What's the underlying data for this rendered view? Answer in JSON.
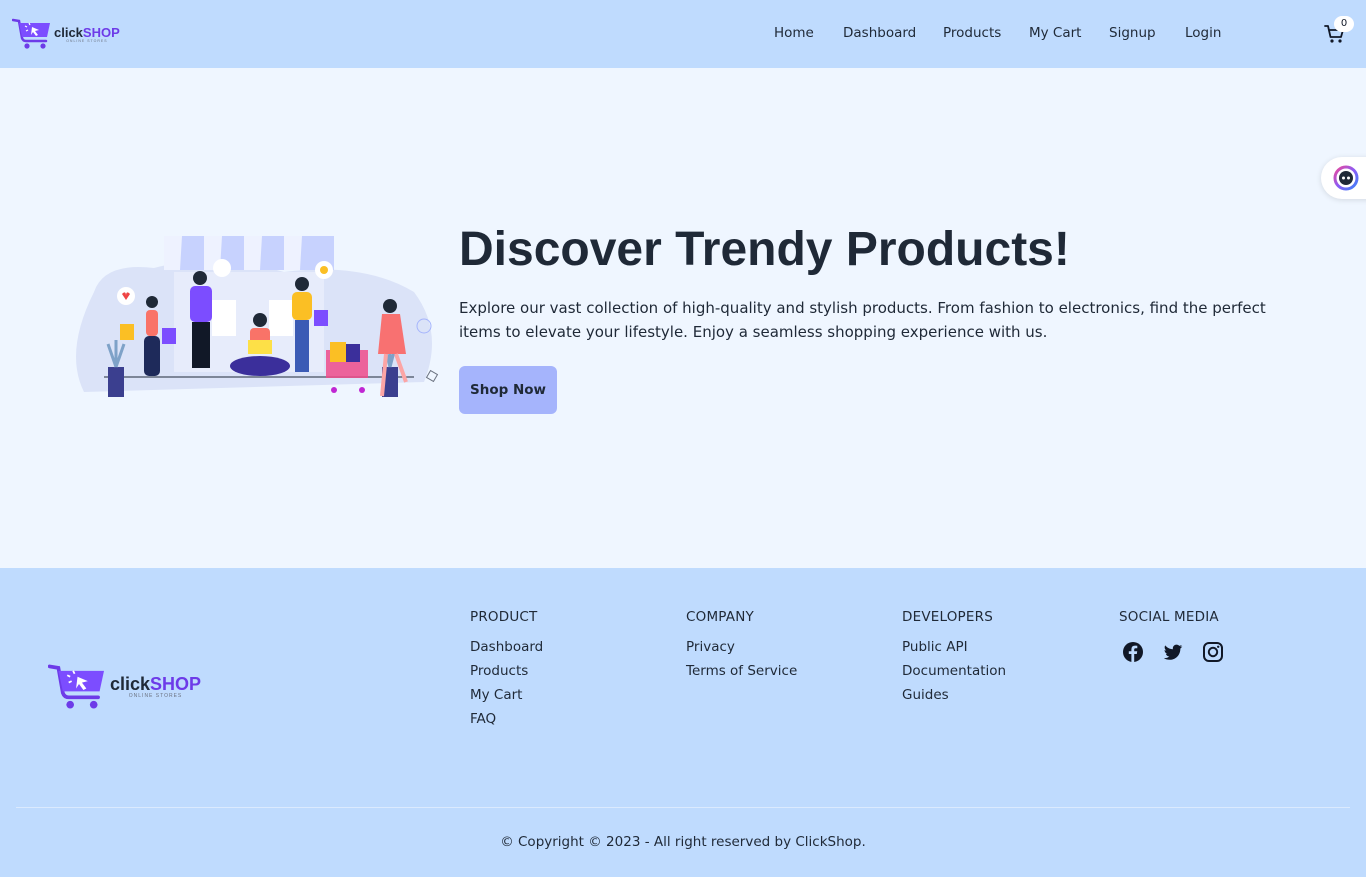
{
  "brand": {
    "name_part1": "click",
    "name_part2": "SHOP",
    "tagline": "ONLINE STORES",
    "accent_color": "#6d3be8"
  },
  "nav": {
    "items": [
      {
        "label": "Home"
      },
      {
        "label": "Dashboard"
      },
      {
        "label": "Products"
      },
      {
        "label": "My Cart"
      },
      {
        "label": "Signup"
      },
      {
        "label": "Login"
      }
    ],
    "cart_icon": "cart-icon",
    "cart_count": "0"
  },
  "side_widget": {
    "icon": "assistant-icon"
  },
  "hero": {
    "title": "Discover Trendy Products!",
    "description": "Explore our vast collection of high-quality and stylish products. From fashion to electronics, find the perfect items to elevate your lifestyle. Enjoy a seamless shopping experience with us.",
    "button_label": "Shop Now",
    "illustration": "shopping-people-illustration"
  },
  "footer": {
    "columns": [
      {
        "title": "PRODUCT",
        "items": [
          "Dashboard",
          "Products",
          "My Cart",
          "FAQ"
        ]
      },
      {
        "title": "COMPANY",
        "items": [
          "Privacy",
          "Terms of Service"
        ]
      },
      {
        "title": "DEVELOPERS",
        "items": [
          "Public API",
          "Documentation",
          "Guides"
        ]
      }
    ],
    "social": {
      "title": "SOCIAL MEDIA",
      "icons": [
        "facebook-icon",
        "twitter-icon",
        "instagram-icon"
      ]
    },
    "copyright": "© Copyright © 2023 - All right reserved by ClickShop."
  },
  "colors": {
    "header_bg": "#bfdbfe",
    "page_bg": "#eff6ff",
    "button_bg": "#a5b4fc",
    "text": "#1f2937"
  }
}
